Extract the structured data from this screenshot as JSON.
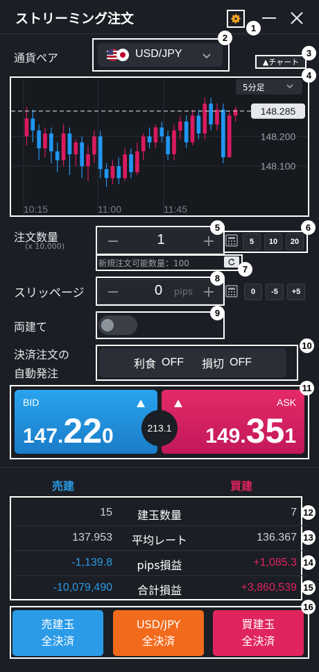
{
  "window": {
    "title": "ストリーミング注文",
    "minimize_icon": "minus-icon",
    "close_icon": "x-icon",
    "settings_icon": "gear-icon"
  },
  "currency_pair": {
    "label": "通貨ペア",
    "value": "USD/JPY",
    "flag_icon": "us-jp-flag-icon",
    "chart_toggle": "▲チャート"
  },
  "chart": {
    "timeframe": "5分足",
    "current_price": "148.285",
    "y_ticks": [
      "148.200",
      "148.100"
    ],
    "x_ticks": [
      "10:15",
      "11:00",
      "11:45"
    ]
  },
  "chart_data": {
    "type": "candlestick",
    "timeframe": "5分足",
    "ylim": [
      148.0,
      148.35
    ],
    "current_price": 148.285,
    "y_ticks": [
      148.2,
      148.1
    ],
    "x_ticks": [
      "10:15",
      "11:00",
      "11:45"
    ],
    "candles": [
      {
        "o": 148.2,
        "c": 148.26,
        "h": 148.3,
        "l": 148.17
      },
      {
        "o": 148.26,
        "c": 148.22,
        "h": 148.29,
        "l": 148.18
      },
      {
        "o": 148.22,
        "c": 148.16,
        "h": 148.24,
        "l": 148.12
      },
      {
        "o": 148.16,
        "c": 148.21,
        "h": 148.23,
        "l": 148.13
      },
      {
        "o": 148.21,
        "c": 148.15,
        "h": 148.23,
        "l": 148.11
      },
      {
        "o": 148.15,
        "c": 148.12,
        "h": 148.18,
        "l": 148.08
      },
      {
        "o": 148.12,
        "c": 148.21,
        "h": 148.24,
        "l": 148.1
      },
      {
        "o": 148.21,
        "c": 148.14,
        "h": 148.23,
        "l": 148.07
      },
      {
        "o": 148.14,
        "c": 148.18,
        "h": 148.19,
        "l": 148.1
      },
      {
        "o": 148.18,
        "c": 148.1,
        "h": 148.2,
        "l": 148.06
      },
      {
        "o": 148.1,
        "c": 148.14,
        "h": 148.17,
        "l": 148.05
      },
      {
        "o": 148.14,
        "c": 148.2,
        "h": 148.22,
        "l": 148.11
      },
      {
        "o": 148.2,
        "c": 148.09,
        "h": 148.22,
        "l": 148.06
      },
      {
        "o": 148.09,
        "c": 148.06,
        "h": 148.11,
        "l": 148.03
      },
      {
        "o": 148.06,
        "c": 148.1,
        "h": 148.12,
        "l": 148.04
      },
      {
        "o": 148.1,
        "c": 148.06,
        "h": 148.13,
        "l": 148.04
      },
      {
        "o": 148.06,
        "c": 148.14,
        "h": 148.16,
        "l": 148.05
      },
      {
        "o": 148.14,
        "c": 148.08,
        "h": 148.16,
        "l": 148.06
      },
      {
        "o": 148.08,
        "c": 148.15,
        "h": 148.18,
        "l": 148.07
      },
      {
        "o": 148.15,
        "c": 148.2,
        "h": 148.21,
        "l": 148.12
      },
      {
        "o": 148.2,
        "c": 148.18,
        "h": 148.23,
        "l": 148.16
      },
      {
        "o": 148.18,
        "c": 148.23,
        "h": 148.24,
        "l": 148.16
      },
      {
        "o": 148.23,
        "c": 148.2,
        "h": 148.25,
        "l": 148.18
      },
      {
        "o": 148.2,
        "c": 148.14,
        "h": 148.22,
        "l": 148.12
      },
      {
        "o": 148.14,
        "c": 148.22,
        "h": 148.24,
        "l": 148.12
      },
      {
        "o": 148.22,
        "c": 148.25,
        "h": 148.27,
        "l": 148.19
      },
      {
        "o": 148.25,
        "c": 148.18,
        "h": 148.27,
        "l": 148.16
      },
      {
        "o": 148.18,
        "c": 148.27,
        "h": 148.29,
        "l": 148.17
      },
      {
        "o": 148.27,
        "c": 148.21,
        "h": 148.29,
        "l": 148.19
      },
      {
        "o": 148.21,
        "c": 148.31,
        "h": 148.33,
        "l": 148.19
      },
      {
        "o": 148.31,
        "c": 148.24,
        "h": 148.33,
        "l": 148.22
      },
      {
        "o": 148.24,
        "c": 148.29,
        "h": 148.31,
        "l": 148.22
      },
      {
        "o": 148.29,
        "c": 148.13,
        "h": 148.31,
        "l": 148.11
      },
      {
        "o": 148.13,
        "c": 148.27,
        "h": 148.28,
        "l": 148.14
      },
      {
        "o": 148.27,
        "c": 148.29,
        "h": 148.3,
        "l": 148.25
      }
    ],
    "colors": {
      "up": "#d81b60",
      "down": "#2196f3"
    }
  },
  "order": {
    "qty_label": "注文数量",
    "qty_unit": "(x 10,000)",
    "qty_value": "1",
    "presets": [
      "5",
      "10",
      "20"
    ],
    "available_label": "新規注文可能数量：100",
    "refresh_icon": "refresh-icon",
    "calculator_icon": "calculator-icon"
  },
  "slippage": {
    "label": "スリッページ",
    "value": "0",
    "unit": "pips",
    "presets": [
      "0",
      "-5",
      "+5"
    ]
  },
  "hedge": {
    "label": "両建て"
  },
  "auto_settle": {
    "label_line1": "決済注文の",
    "label_line2": "自動発注",
    "take_profit": "利食",
    "take_profit_state": "OFF",
    "stop_loss": "損切",
    "stop_loss_state": "OFF"
  },
  "prices": {
    "bid_label": "BID",
    "bid_main": "147.",
    "bid_big": "22",
    "bid_small": "0",
    "ask_label": "ASK",
    "ask_main": "149.",
    "ask_big": "35",
    "ask_small": "1",
    "spread": "213.1",
    "up_icon": "triangle-up-icon"
  },
  "positions": {
    "sell_header": "売建",
    "buy_header": "買建",
    "rows": [
      {
        "sell": "15",
        "label": "建玉数量",
        "buy": "7"
      },
      {
        "sell": "137.953",
        "label": "平均レート",
        "buy": "136.367"
      },
      {
        "sell": "-1,139.8",
        "label": "pips損益",
        "buy": "+1,085.3"
      },
      {
        "sell": "-10,079,490",
        "label": "合計損益",
        "buy": "+3,860,539"
      }
    ]
  },
  "actions": {
    "sell_all_line1": "売建玉",
    "sell_all_line2": "全決済",
    "pair_all_line1": "USD/JPY",
    "pair_all_line2": "全決済",
    "buy_all_line1": "買建玉",
    "buy_all_line2": "全決済"
  },
  "callouts": [
    "1",
    "2",
    "3",
    "4",
    "5",
    "6",
    "7",
    "8",
    "9",
    "10",
    "11",
    "12",
    "13",
    "14",
    "15",
    "16"
  ],
  "colors": {
    "sell": "#2b9be8",
    "buy": "#e0245e",
    "orange": "#f26a1b",
    "background": "#1b1e24"
  }
}
